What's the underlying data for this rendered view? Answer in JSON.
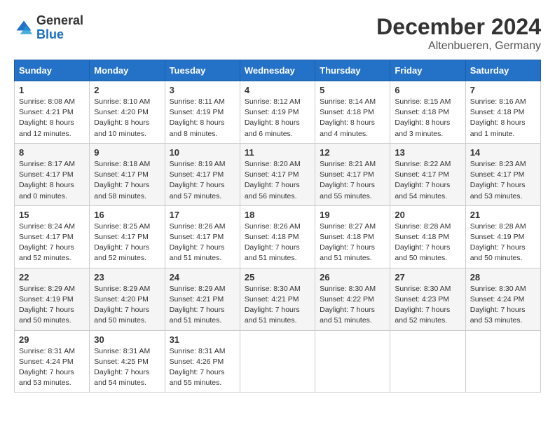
{
  "header": {
    "logo_general": "General",
    "logo_blue": "Blue",
    "month": "December 2024",
    "location": "Altenbueren, Germany"
  },
  "weekdays": [
    "Sunday",
    "Monday",
    "Tuesday",
    "Wednesday",
    "Thursday",
    "Friday",
    "Saturday"
  ],
  "weeks": [
    [
      {
        "day": "1",
        "info": "Sunrise: 8:08 AM\nSunset: 4:21 PM\nDaylight: 8 hours\nand 12 minutes."
      },
      {
        "day": "2",
        "info": "Sunrise: 8:10 AM\nSunset: 4:20 PM\nDaylight: 8 hours\nand 10 minutes."
      },
      {
        "day": "3",
        "info": "Sunrise: 8:11 AM\nSunset: 4:19 PM\nDaylight: 8 hours\nand 8 minutes."
      },
      {
        "day": "4",
        "info": "Sunrise: 8:12 AM\nSunset: 4:19 PM\nDaylight: 8 hours\nand 6 minutes."
      },
      {
        "day": "5",
        "info": "Sunrise: 8:14 AM\nSunset: 4:18 PM\nDaylight: 8 hours\nand 4 minutes."
      },
      {
        "day": "6",
        "info": "Sunrise: 8:15 AM\nSunset: 4:18 PM\nDaylight: 8 hours\nand 3 minutes."
      },
      {
        "day": "7",
        "info": "Sunrise: 8:16 AM\nSunset: 4:18 PM\nDaylight: 8 hours\nand 1 minute."
      }
    ],
    [
      {
        "day": "8",
        "info": "Sunrise: 8:17 AM\nSunset: 4:17 PM\nDaylight: 8 hours\nand 0 minutes."
      },
      {
        "day": "9",
        "info": "Sunrise: 8:18 AM\nSunset: 4:17 PM\nDaylight: 7 hours\nand 58 minutes."
      },
      {
        "day": "10",
        "info": "Sunrise: 8:19 AM\nSunset: 4:17 PM\nDaylight: 7 hours\nand 57 minutes."
      },
      {
        "day": "11",
        "info": "Sunrise: 8:20 AM\nSunset: 4:17 PM\nDaylight: 7 hours\nand 56 minutes."
      },
      {
        "day": "12",
        "info": "Sunrise: 8:21 AM\nSunset: 4:17 PM\nDaylight: 7 hours\nand 55 minutes."
      },
      {
        "day": "13",
        "info": "Sunrise: 8:22 AM\nSunset: 4:17 PM\nDaylight: 7 hours\nand 54 minutes."
      },
      {
        "day": "14",
        "info": "Sunrise: 8:23 AM\nSunset: 4:17 PM\nDaylight: 7 hours\nand 53 minutes."
      }
    ],
    [
      {
        "day": "15",
        "info": "Sunrise: 8:24 AM\nSunset: 4:17 PM\nDaylight: 7 hours\nand 52 minutes."
      },
      {
        "day": "16",
        "info": "Sunrise: 8:25 AM\nSunset: 4:17 PM\nDaylight: 7 hours\nand 52 minutes."
      },
      {
        "day": "17",
        "info": "Sunrise: 8:26 AM\nSunset: 4:17 PM\nDaylight: 7 hours\nand 51 minutes."
      },
      {
        "day": "18",
        "info": "Sunrise: 8:26 AM\nSunset: 4:18 PM\nDaylight: 7 hours\nand 51 minutes."
      },
      {
        "day": "19",
        "info": "Sunrise: 8:27 AM\nSunset: 4:18 PM\nDaylight: 7 hours\nand 51 minutes."
      },
      {
        "day": "20",
        "info": "Sunrise: 8:28 AM\nSunset: 4:18 PM\nDaylight: 7 hours\nand 50 minutes."
      },
      {
        "day": "21",
        "info": "Sunrise: 8:28 AM\nSunset: 4:19 PM\nDaylight: 7 hours\nand 50 minutes."
      }
    ],
    [
      {
        "day": "22",
        "info": "Sunrise: 8:29 AM\nSunset: 4:19 PM\nDaylight: 7 hours\nand 50 minutes."
      },
      {
        "day": "23",
        "info": "Sunrise: 8:29 AM\nSunset: 4:20 PM\nDaylight: 7 hours\nand 50 minutes."
      },
      {
        "day": "24",
        "info": "Sunrise: 8:29 AM\nSunset: 4:21 PM\nDaylight: 7 hours\nand 51 minutes."
      },
      {
        "day": "25",
        "info": "Sunrise: 8:30 AM\nSunset: 4:21 PM\nDaylight: 7 hours\nand 51 minutes."
      },
      {
        "day": "26",
        "info": "Sunrise: 8:30 AM\nSunset: 4:22 PM\nDaylight: 7 hours\nand 51 minutes."
      },
      {
        "day": "27",
        "info": "Sunrise: 8:30 AM\nSunset: 4:23 PM\nDaylight: 7 hours\nand 52 minutes."
      },
      {
        "day": "28",
        "info": "Sunrise: 8:30 AM\nSunset: 4:24 PM\nDaylight: 7 hours\nand 53 minutes."
      }
    ],
    [
      {
        "day": "29",
        "info": "Sunrise: 8:31 AM\nSunset: 4:24 PM\nDaylight: 7 hours\nand 53 minutes."
      },
      {
        "day": "30",
        "info": "Sunrise: 8:31 AM\nSunset: 4:25 PM\nDaylight: 7 hours\nand 54 minutes."
      },
      {
        "day": "31",
        "info": "Sunrise: 8:31 AM\nSunset: 4:26 PM\nDaylight: 7 hours\nand 55 minutes."
      },
      null,
      null,
      null,
      null
    ]
  ]
}
